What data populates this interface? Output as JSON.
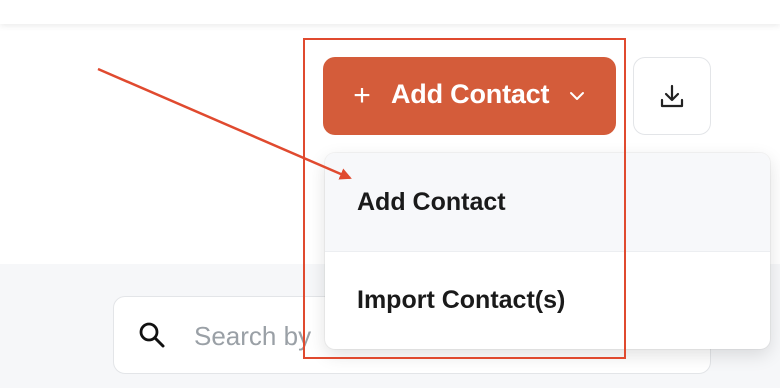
{
  "colors": {
    "accent": "#d45c3a",
    "annotation": "#e04a2f"
  },
  "toolbar": {
    "add_contact_label": "Add Contact",
    "plus_glyph": "+",
    "add_icon": "plus-icon",
    "dropdown_icon": "chevron-down-icon",
    "download_icon": "download-icon"
  },
  "dropdown": {
    "items": [
      {
        "label": "Add Contact"
      },
      {
        "label": "Import Contact(s)"
      }
    ]
  },
  "search": {
    "placeholder": "Search by",
    "icon": "search-icon"
  }
}
